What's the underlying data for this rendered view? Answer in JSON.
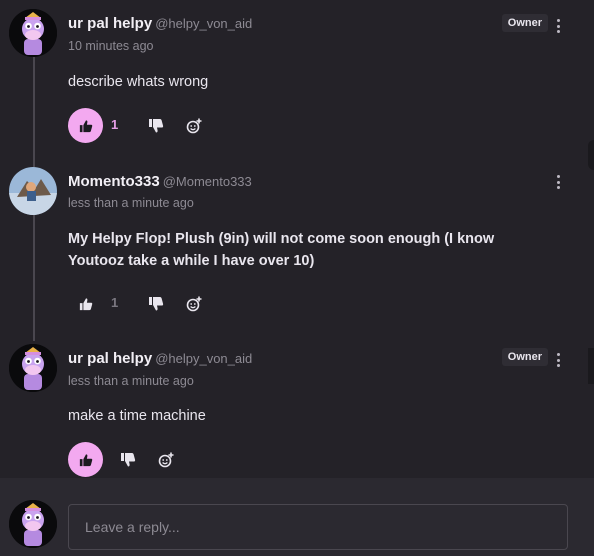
{
  "comments": [
    {
      "author": "ur pal helpy",
      "handle": "@helpy_von_aid",
      "time": "10 minutes ago",
      "body": "describe whats wrong",
      "badge": "Owner",
      "likes": "1"
    },
    {
      "author": "Momento333",
      "handle": "@Momento333",
      "time": "less than a minute ago",
      "body": "My Helpy Flop! Plush (9in) will not come soon enough (I know Youtooz take a while I have over 10)",
      "likes": "1"
    },
    {
      "author": "ur pal helpy",
      "handle": "@helpy_von_aid",
      "time": "less than a minute ago",
      "body": "make a time machine",
      "badge": "Owner"
    }
  ],
  "reply": {
    "placeholder": "Leave a reply..."
  },
  "colors": {
    "background": "#242228",
    "accent_pink": "#f3a9f0",
    "muted_text": "#8d8a93"
  },
  "icons": [
    "thumbs-up-icon",
    "thumbs-down-icon",
    "add-reaction-icon",
    "more-options-icon"
  ]
}
